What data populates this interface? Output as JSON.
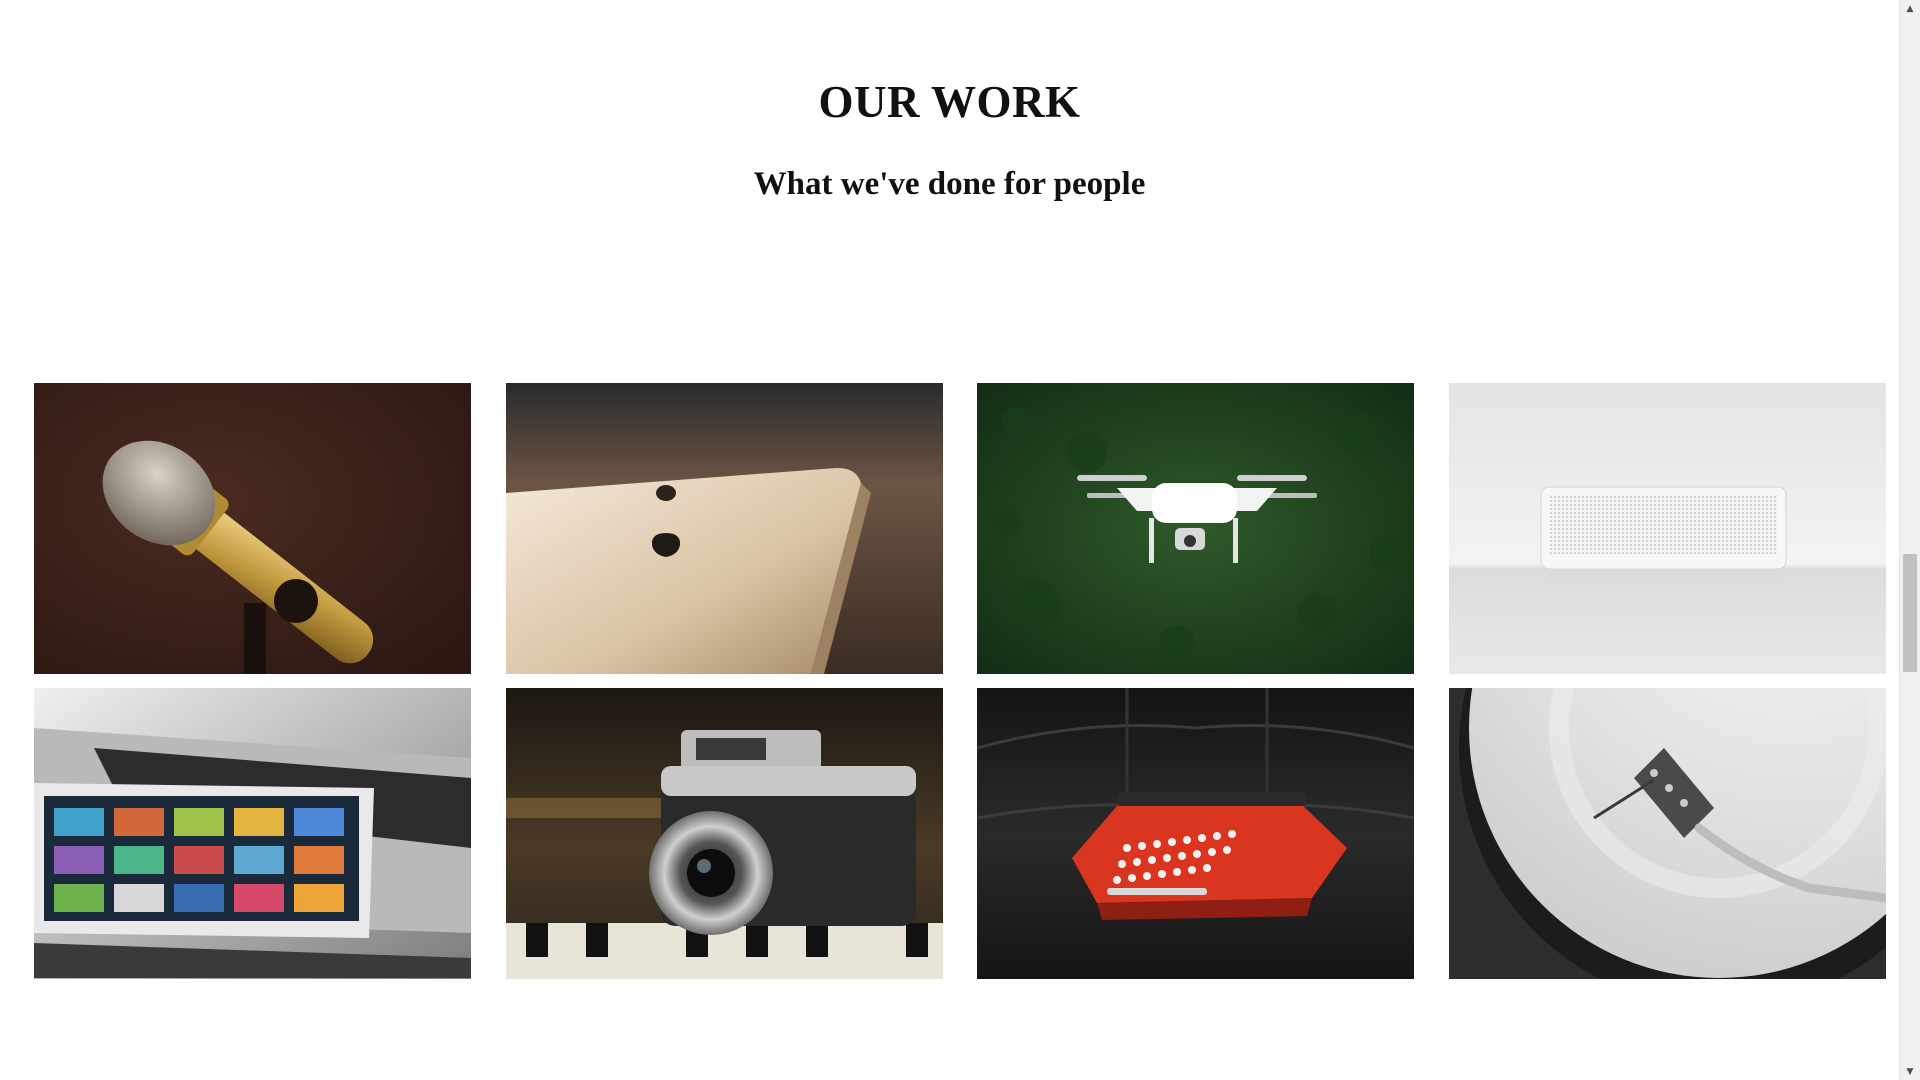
{
  "section": {
    "title": "OUR WORK",
    "subtitle": "What we've done for people"
  },
  "gallery": {
    "items": [
      {
        "icon": "microphone-photo"
      },
      {
        "icon": "smartphone-photo"
      },
      {
        "icon": "drone-photo"
      },
      {
        "icon": "speaker-photo"
      },
      {
        "icon": "tablet-laptop-photo"
      },
      {
        "icon": "camera-photo"
      },
      {
        "icon": "typewriter-photo"
      },
      {
        "icon": "turntable-photo"
      }
    ]
  },
  "colors": {
    "background": "#ffffff",
    "text": "#111111",
    "scrollbar_track": "#f1f1f1",
    "scrollbar_thumb": "#c1c1c1"
  }
}
